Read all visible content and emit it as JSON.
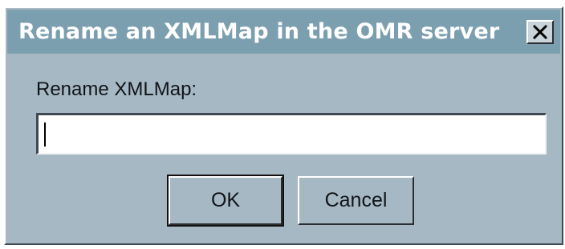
{
  "dialog": {
    "title": "Rename an XMLMap in the OMR server",
    "close_icon": "close-icon"
  },
  "form": {
    "label": "Rename XMLMap:",
    "input_value": "",
    "input_placeholder": ""
  },
  "buttons": {
    "ok_label": "OK",
    "cancel_label": "Cancel"
  },
  "colors": {
    "dialog_bg": "#a6b8c4",
    "titlebar_bg": "#7c9fb0",
    "title_text": "#ffffff"
  }
}
